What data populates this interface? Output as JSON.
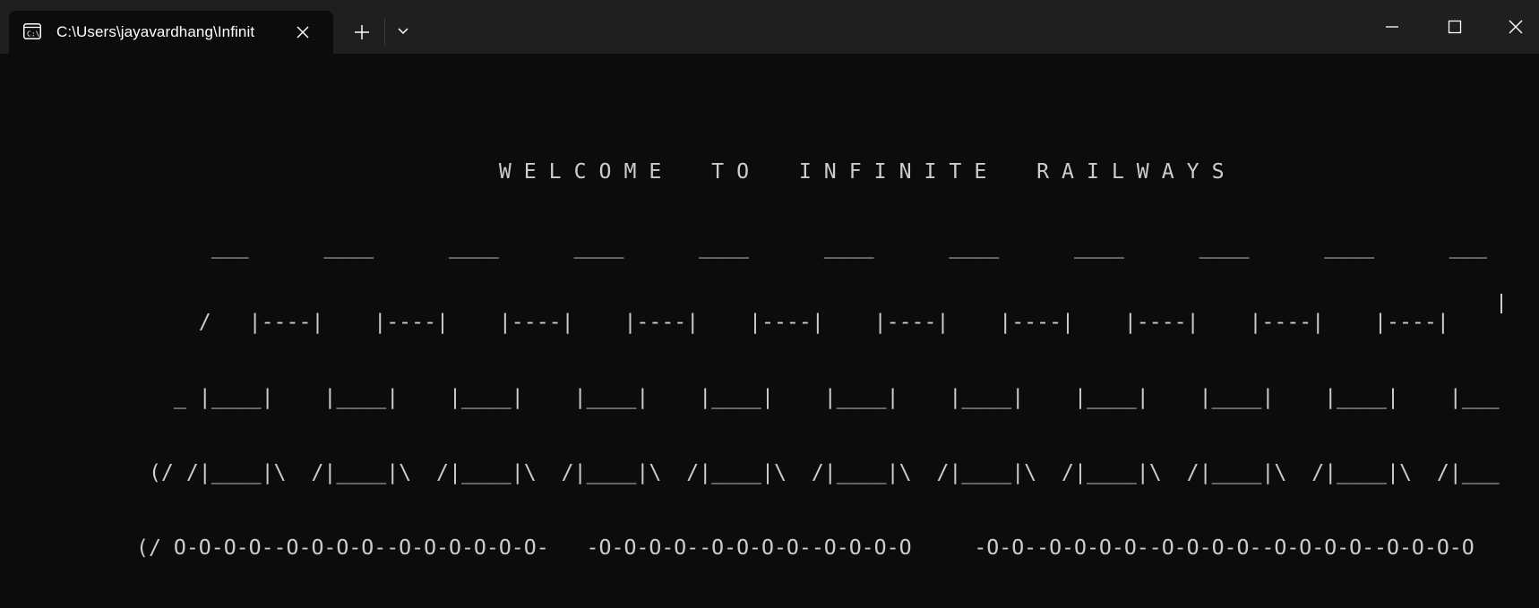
{
  "window": {
    "tab_title": "C:\\Users\\jayavardhang\\Infinit",
    "tab_icon": "terminal-icon",
    "background": "#0c0c0c",
    "titlebar_color": "#1f1f1f",
    "text_color": "#cccccc"
  },
  "terminal": {
    "lines": [
      "                             W E L C O M E    T O    I N F I N I T E    R A I L W A Y S",
      "      ___      ____      ____      ____      ____      ____      ____      ____      ____      ____      ___",
      "     /   |----|    |----|    |----|    |----|    |----|    |----|    |----|    |----|    |----|    |----|",
      "   _ |____|    |____|    |____|    |____|    |____|    |____|    |____|    |____|    |____|    |____|    |___",
      " (/ /|____|\\  /|____|\\  /|____|\\  /|____|\\  /|____|\\  /|____|\\  /|____|\\  /|____|\\  /|____|\\  /|____|\\  /|___",
      "(/ O-O-O-O--O-O-O-O--O-O-O-O-O-O-   -O-O-O-O--O-O-O-O--O-O-O-O     -O-O--O-O-O-O--O-O-O-O--O-O-O-O--O-O-O-O"
    ]
  }
}
